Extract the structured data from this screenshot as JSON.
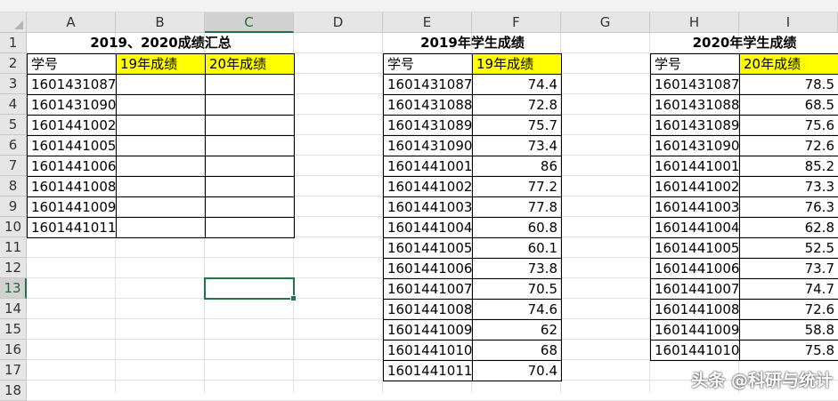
{
  "columns": [
    "A",
    "B",
    "C",
    "D",
    "E",
    "F",
    "G",
    "H",
    "I"
  ],
  "selected_column": "C",
  "rows": [
    "1",
    "2",
    "3",
    "4",
    "5",
    "6",
    "7",
    "8",
    "9",
    "10",
    "11",
    "12",
    "13",
    "14",
    "15",
    "16",
    "17",
    "18"
  ],
  "selected_row": "13",
  "table1": {
    "title": "2019、2020成绩汇总",
    "headers": [
      "学号",
      "19年成绩",
      "20年成绩"
    ],
    "ids": [
      "1601431087",
      "1601431090",
      "1601441002",
      "1601441005",
      "1601441006",
      "1601441008",
      "1601441009",
      "1601441011"
    ]
  },
  "table2": {
    "title": "2019年学生成绩",
    "headers": [
      "学号",
      "19年成绩"
    ],
    "rows": [
      [
        "1601431087",
        "74.4"
      ],
      [
        "1601431088",
        "72.8"
      ],
      [
        "1601431089",
        "75.7"
      ],
      [
        "1601431090",
        "73.4"
      ],
      [
        "1601441001",
        "86"
      ],
      [
        "1601441002",
        "77.2"
      ],
      [
        "1601441003",
        "77.8"
      ],
      [
        "1601441004",
        "60.8"
      ],
      [
        "1601441005",
        "60.1"
      ],
      [
        "1601441006",
        "73.8"
      ],
      [
        "1601441007",
        "70.5"
      ],
      [
        "1601441008",
        "74.6"
      ],
      [
        "1601441009",
        "62"
      ],
      [
        "1601441010",
        "68"
      ],
      [
        "1601441011",
        "70.4"
      ]
    ]
  },
  "table3": {
    "title": "2020年学生成绩",
    "headers": [
      "学号",
      "20年成绩"
    ],
    "rows": [
      [
        "1601431087",
        "78.5"
      ],
      [
        "1601431088",
        "68.5"
      ],
      [
        "1601431089",
        "75.6"
      ],
      [
        "1601431090",
        "72.6"
      ],
      [
        "1601441001",
        "85.2"
      ],
      [
        "1601441002",
        "73.3"
      ],
      [
        "1601441003",
        "76.3"
      ],
      [
        "1601441004",
        "62.8"
      ],
      [
        "1601441005",
        "52.5"
      ],
      [
        "1601441006",
        "73.7"
      ],
      [
        "1601441007",
        "74.7"
      ],
      [
        "1601441008",
        "72.6"
      ],
      [
        "1601441009",
        "58.8"
      ],
      [
        "1601441010",
        "75.8"
      ]
    ]
  },
  "watermark": "头条 @科研与统计",
  "colors": {
    "header_bg": "#e6e6e6",
    "selection": "#217346",
    "highlight": "#ffff00"
  }
}
